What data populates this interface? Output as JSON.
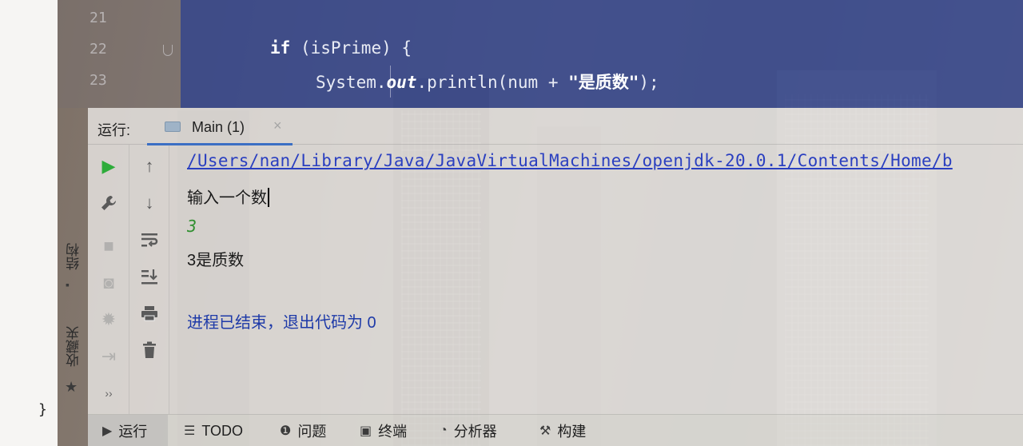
{
  "editor": {
    "line_numbers": [
      "21",
      "22",
      "23"
    ],
    "code_if": "if",
    "code_cond": " (isPrime) {",
    "code_sys": "System.",
    "code_out": "out",
    "code_println": ".println(num + ",
    "code_str": "\"是质数\"",
    "code_end": ");"
  },
  "outside": {
    "closing_brace": "}"
  },
  "run": {
    "header_label": "运行:",
    "tab_label": "Main (1)",
    "tab_close": "×"
  },
  "console": {
    "path": "/Users/nan/Library/Java/JavaVirtualMachines/openjdk-20.0.1/Contents/Home/b",
    "prompt": "输入一个数",
    "user_input": "3",
    "result": "3是质数",
    "exit_message": "进程已结束，退出代码为 0"
  },
  "sidebar": {
    "structure_label": "结构",
    "favorites_label": "收藏夹",
    "more": "››"
  },
  "bottom_tabs": [
    {
      "label": "运行",
      "icon": "play-icon"
    },
    {
      "label": "TODO",
      "icon": "list-icon"
    },
    {
      "label": "问题",
      "icon": "problems-icon"
    },
    {
      "label": "终端",
      "icon": "terminal-icon"
    },
    {
      "label": "分析器",
      "icon": "profiler-icon"
    },
    {
      "label": "构建",
      "icon": "build-icon"
    }
  ],
  "colors": {
    "code_bg": "#30428c",
    "link_blue": "#2a3fc0",
    "input_green": "#2f8f2f",
    "run_green": "#2eac3a",
    "tab_accent": "#3b6fc4"
  }
}
